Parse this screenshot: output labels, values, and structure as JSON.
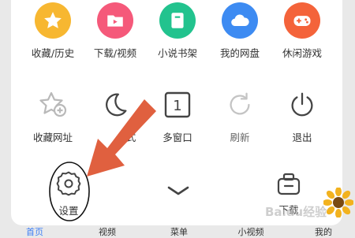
{
  "menu": {
    "row1": [
      {
        "label": "收藏/历史",
        "icon": "star-icon",
        "color": "#f7b731"
      },
      {
        "label": "下载/视频",
        "icon": "video-folder-icon",
        "color": "#f5597a"
      },
      {
        "label": "小说书架",
        "icon": "book-icon",
        "color": "#22c38e"
      },
      {
        "label": "我的网盘",
        "icon": "cloud-icon",
        "color": "#3d8bf2"
      },
      {
        "label": "休闲游戏",
        "icon": "gamepad-icon",
        "color": "#f4633a"
      }
    ],
    "row2": [
      {
        "label": "收藏网址",
        "icon": "add-bookmark-icon"
      },
      {
        "label": "...式",
        "icon": "night-mode-icon"
      },
      {
        "label": "多窗口",
        "icon": "window-count-icon",
        "count": "1"
      },
      {
        "label": "刷新",
        "icon": "refresh-icon"
      },
      {
        "label": "退出",
        "icon": "power-icon"
      }
    ],
    "row3": [
      {
        "label": "设置",
        "icon": "gear-icon"
      },
      {
        "label": "下载",
        "icon": "toolbox-icon"
      }
    ]
  },
  "bottom_nav": [
    "首页",
    "视频",
    "菜单",
    "小视频",
    "我的"
  ],
  "colors": {
    "annotation_arrow": "#e0603f",
    "active_nav": "#3d7ff5"
  },
  "watermark": "Baidu经验"
}
